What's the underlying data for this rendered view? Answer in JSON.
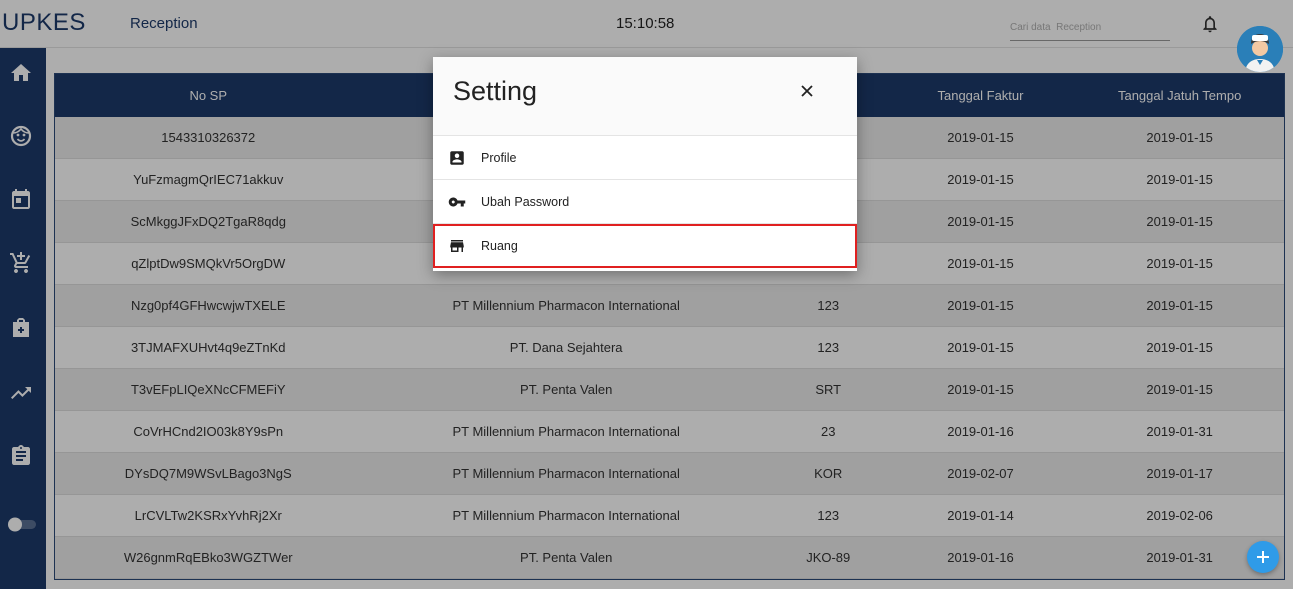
{
  "app": {
    "brand": "UPKES",
    "page": "Reception",
    "clock": "15:10:58"
  },
  "search": {
    "placeholder": "Cari data  Reception"
  },
  "sidebar": {
    "items": [
      {
        "icon": "home-icon"
      },
      {
        "icon": "face-icon"
      },
      {
        "icon": "calendar-icon"
      },
      {
        "icon": "add-cart-icon"
      },
      {
        "icon": "medical-add-icon"
      },
      {
        "icon": "trending-up-icon"
      },
      {
        "icon": "clipboard-icon"
      },
      {
        "icon": "toggle-icon"
      }
    ]
  },
  "table": {
    "headers": [
      "No SP",
      "",
      "",
      "Tanggal Faktur",
      "Tanggal Jatuh Tempo"
    ],
    "rows": [
      [
        "1543310326372",
        "",
        "",
        "2019-01-15",
        "2019-01-15"
      ],
      [
        "YuFzmagmQrIEC71akkuv",
        "",
        "",
        "2019-01-15",
        "2019-01-15"
      ],
      [
        "ScMkggJFxDQ2TgaR8qdg",
        "",
        "",
        "2019-01-15",
        "2019-01-15"
      ],
      [
        "qZlptDw9SMQkVr5OrgDW",
        "",
        "",
        "2019-01-15",
        "2019-01-15"
      ],
      [
        "Nzg0pf4GFHwcwjwTXELE",
        "PT Millennium Pharmacon International",
        "123",
        "2019-01-15",
        "2019-01-15"
      ],
      [
        "3TJMAFXUHvt4q9eZTnKd",
        "PT. Dana Sejahtera",
        "123",
        "2019-01-15",
        "2019-01-15"
      ],
      [
        "T3vEFpLIQeXNcCFMEFiY",
        "PT. Penta Valen",
        "SRT",
        "2019-01-15",
        "2019-01-15"
      ],
      [
        "CoVrHCnd2IO03k8Y9sPn",
        "PT Millennium Pharmacon International",
        "23",
        "2019-01-16",
        "2019-01-31"
      ],
      [
        "DYsDQ7M9WSvLBago3NgS",
        "PT Millennium Pharmacon International",
        "KOR",
        "2019-02-07",
        "2019-01-17"
      ],
      [
        "LrCVLTw2KSRxYvhRj2Xr",
        "PT Millennium Pharmacon International",
        "123",
        "2019-01-14",
        "2019-02-06"
      ],
      [
        "W26gnmRqEBko3WGZTWer",
        "PT. Penta Valen",
        "JKO-89",
        "2019-01-16",
        "2019-01-31"
      ]
    ]
  },
  "modal": {
    "title": "Setting",
    "items": [
      {
        "label": "Profile",
        "icon": "account-box-icon"
      },
      {
        "label": "Ubah Password",
        "icon": "key-icon"
      },
      {
        "label": "Ruang",
        "icon": "store-icon",
        "highlighted": true
      }
    ]
  },
  "colors": {
    "primary": "#1d3a6b",
    "fab": "#2f9be8",
    "highlight": "#e02020"
  }
}
